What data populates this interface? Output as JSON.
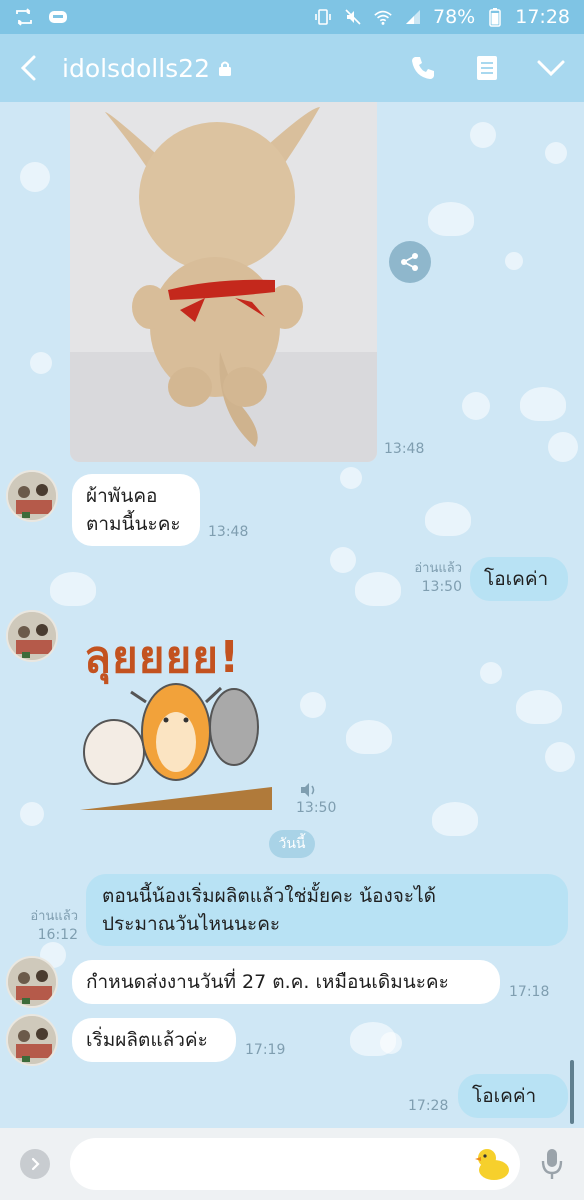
{
  "status_bar": {
    "battery": "78%",
    "time": "17:28",
    "left_icons": [
      "retweet-icon",
      "line-badge-icon"
    ],
    "right_icons": [
      "vibrate-icon",
      "mute-icon",
      "wifi-icon",
      "signal-icon",
      "battery-icon"
    ]
  },
  "header": {
    "title": "idolsdolls22",
    "icons": [
      "back-icon",
      "lock-icon",
      "phone-icon",
      "notes-icon",
      "chevron-down-icon"
    ]
  },
  "messages": [
    {
      "type": "image",
      "sender": "them",
      "time": "13:48",
      "share_icon": "share-icon"
    },
    {
      "type": "text",
      "sender": "them",
      "lines": [
        "ผ้าพันคอ",
        "ตามนี้นะคะ"
      ],
      "time": "13:48"
    },
    {
      "type": "text",
      "sender": "me",
      "text": "โอเคค่า",
      "read_label": "อ่านแล้ว",
      "time": "13:50"
    },
    {
      "type": "sticker",
      "sender": "them",
      "sticker_text": "ลุยยยย!",
      "time": "13:50",
      "sound_icon": "speaker-icon"
    },
    {
      "type": "text",
      "sender": "me",
      "lines": [
        "ตอนนี้น้องเริ่มผลิตแล้วใช่มั้ยคะ น้องจะได้",
        "ประมาณวันไหนนะคะ"
      ],
      "read_label": "อ่านแล้ว",
      "time": "16:12"
    },
    {
      "type": "text",
      "sender": "them",
      "text": "กำหนดส่งงานวันที่ 27 ต.ค. เหมือนเดิมนะคะ",
      "time": "17:18"
    },
    {
      "type": "text",
      "sender": "them",
      "text": "เริ่มผลิตแล้วค่ะ",
      "time": "17:19"
    },
    {
      "type": "text",
      "sender": "me",
      "text": "โอเคค่า",
      "time": "17:28"
    }
  ],
  "day_divider": "วันนี้",
  "input_bar": {
    "placeholder": "",
    "icons": [
      "expand-icon",
      "duck-emoji-icon",
      "mic-icon"
    ]
  },
  "colors": {
    "status_bar": "#7fc4e4",
    "header": "#a8d8ef",
    "chat_background": "#cfe7f5",
    "incoming_bubble": "#ffffff",
    "outgoing_bubble": "#b8e2f4",
    "timestamp": "#7f9eb0"
  }
}
